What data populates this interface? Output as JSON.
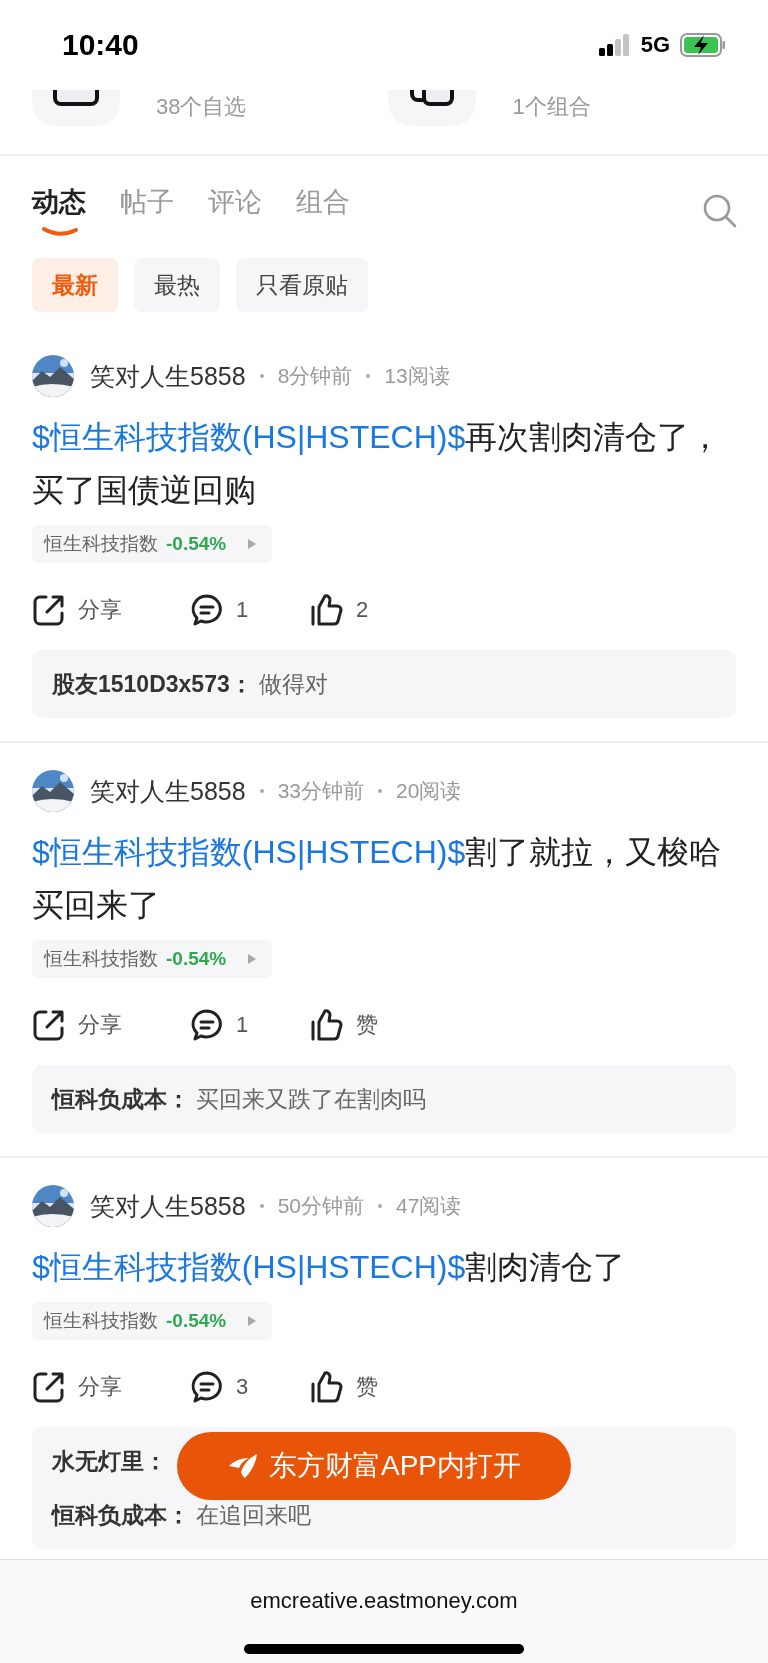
{
  "status_bar": {
    "time": "10:40",
    "network": "5G"
  },
  "shortcuts": [
    {
      "label": "38个自选"
    },
    {
      "label": "1个组合"
    }
  ],
  "tabs": [
    {
      "label": "动态",
      "selected": true
    },
    {
      "label": "帖子",
      "selected": false
    },
    {
      "label": "评论",
      "selected": false
    },
    {
      "label": "组合",
      "selected": false
    }
  ],
  "filters": [
    {
      "label": "最新",
      "selected": true
    },
    {
      "label": "最热",
      "selected": false
    },
    {
      "label": "只看原贴",
      "selected": false
    }
  ],
  "posts": [
    {
      "author": "笑对人生5858",
      "time": "8分钟前",
      "reads": "13阅读",
      "stock_tag": "$恒生科技指数(HS|HSTECH)$",
      "text": "再次割肉清仓了，买了国债逆回购",
      "quote": {
        "name": "恒生科技指数",
        "change": "-0.54%"
      },
      "share": "分享",
      "comments": "1",
      "likes": "2",
      "replies": [
        {
          "user": "股友1510D3x573：",
          "text": "做得对"
        }
      ]
    },
    {
      "author": "笑对人生5858",
      "time": "33分钟前",
      "reads": "20阅读",
      "stock_tag": "$恒生科技指数(HS|HSTECH)$",
      "text": "割了就拉，又梭哈买回来了",
      "quote": {
        "name": "恒生科技指数",
        "change": "-0.54%"
      },
      "share": "分享",
      "comments": "1",
      "likes": "赞",
      "replies": [
        {
          "user": "恒科负成本：",
          "text": "买回来又跌了在割肉吗"
        }
      ]
    },
    {
      "author": "笑对人生5858",
      "time": "50分钟前",
      "reads": "47阅读",
      "stock_tag": "$恒生科技指数(HS|HSTECH)$",
      "text": "割肉清仓了",
      "quote": {
        "name": "恒生科技指数",
        "change": "-0.54%"
      },
      "share": "分享",
      "comments": "3",
      "likes": "赞",
      "replies": [
        {
          "user": "水无灯里："
        },
        {
          "user": "恒科负成本：",
          "text": "在追回来吧"
        }
      ]
    }
  ],
  "open_app_button": "东方财富APP内打开",
  "url": "emcreative.eastmoney.com"
}
